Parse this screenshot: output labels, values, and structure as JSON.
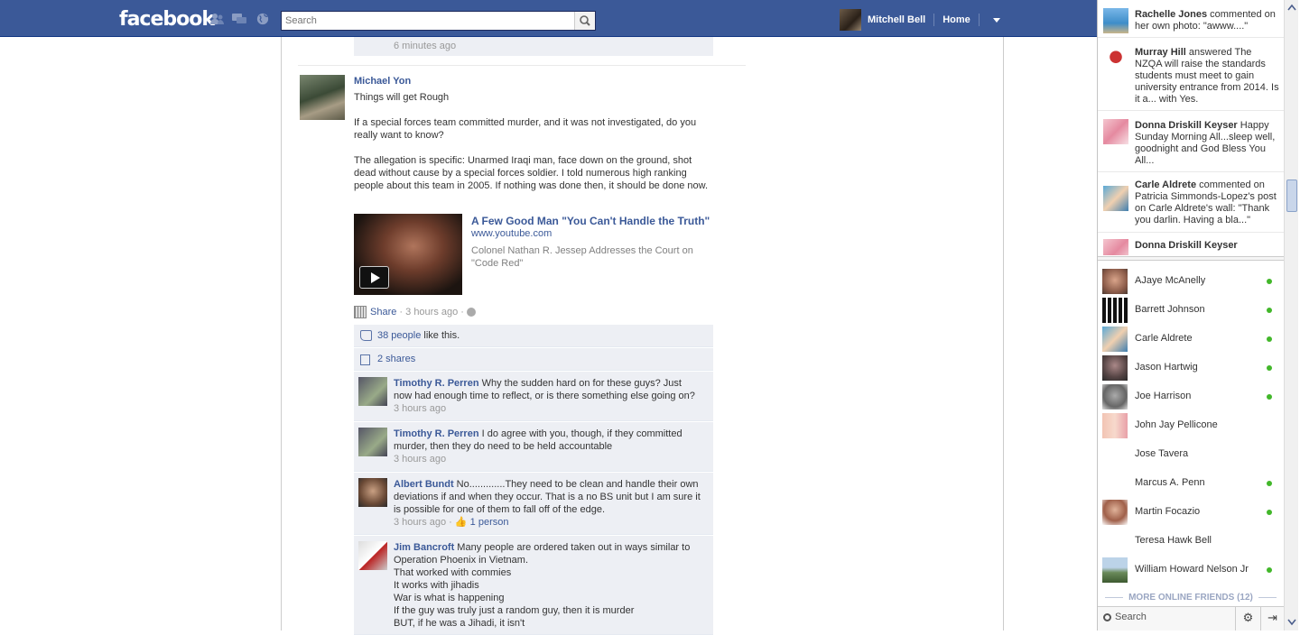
{
  "header": {
    "logo": "facebook",
    "search_placeholder": "Search",
    "user_name": "Mitchell Bell",
    "home_label": "Home"
  },
  "feed": {
    "previous_time": "6 minutes ago",
    "post": {
      "author": "Michael Yon",
      "paragraphs": [
        "Things will get Rough",
        "If a special forces team committed murder, and it was not investigated, do you really want to know?",
        "The allegation is specific: Unarmed Iraqi man, face down on the ground, shot dead without cause by a special forces soldier. I told numerous high ranking people about this team in 2005. If nothing was done then, it should be done now."
      ],
      "link": {
        "title": "A Few Good Man \"You Can't Handle the Truth\"",
        "domain": "www.youtube.com",
        "description": "Colonel Nathan R. Jessep Addresses the Court on \"Code Red\""
      },
      "share_label": "Share",
      "time": "3 hours ago",
      "likes_link": "38 people",
      "likes_suffix": " like this.",
      "shares_label": "2 shares"
    },
    "comments": [
      {
        "author": "Timothy R. Perren",
        "text": " Why the sudden hard on for these guys? Just now had enough time to reflect, or is there something else going on?",
        "time": "3 hours ago",
        "likes": ""
      },
      {
        "author": "Timothy R. Perren",
        "text": " I do agree with you, though, if they committed murder, then they do need to be held accountable",
        "time": "3 hours ago",
        "likes": ""
      },
      {
        "author": "Albert Bundt",
        "text": " No.............They need to be clean and handle their own deviations if and when they occur. That is a no BS unit but I am sure it is possible for one of them to fall off of the edge.",
        "time": "3 hours ago",
        "likes": "1 person"
      },
      {
        "author": "Jim Bancroft",
        "text": " Many people are ordered taken out in ways similar to Operation Phoenix in Vietnam.",
        "lines": [
          "That worked with commies",
          "It works with jihadis",
          "War is what is happening",
          "If the guy was truly just a random guy, then it is murder",
          "BUT, if he was a Jihadi, it isn't"
        ]
      }
    ]
  },
  "ticker": [
    {
      "name": "Rachelle Jones",
      "text": " commented on her own photo: \"awww....\""
    },
    {
      "name": "Murray Hill",
      "text": " answered The NZQA will raise the standards students must meet to gain university entrance from 2014. Is it a... with Yes."
    },
    {
      "name": "Donna Driskill Keyser",
      "text": " Happy Sunday Morning All...sleep well, goodnight and God Bless You All..."
    },
    {
      "name": "Carle Aldrete",
      "text": " commented on Patricia Simmonds-Lopez's post on Carle Aldrete's wall: \"Thank you darlin. Having a bla...\""
    },
    {
      "name": "Donna Driskill Keyser",
      "text": ""
    }
  ],
  "chat": {
    "friends": [
      {
        "name": "AJaye McAnelly",
        "online": true
      },
      {
        "name": "Barrett Johnson",
        "online": true
      },
      {
        "name": "Carle Aldrete",
        "online": true
      },
      {
        "name": "Jason Hartwig",
        "online": true
      },
      {
        "name": "Joe Harrison",
        "online": true
      },
      {
        "name": "John Jay Pellicone",
        "online": false
      },
      {
        "name": "Jose Tavera",
        "online": false
      },
      {
        "name": "Marcus A. Penn",
        "online": true
      },
      {
        "name": "Martin Focazio",
        "online": true
      },
      {
        "name": "Teresa Hawk Bell",
        "online": false
      },
      {
        "name": "William Howard Nelson Jr",
        "online": true
      }
    ],
    "more_label": "MORE ONLINE FRIENDS (12)",
    "search_label": "Search"
  },
  "colors": {
    "brand": "#3b5998",
    "online": "#42b72a"
  }
}
